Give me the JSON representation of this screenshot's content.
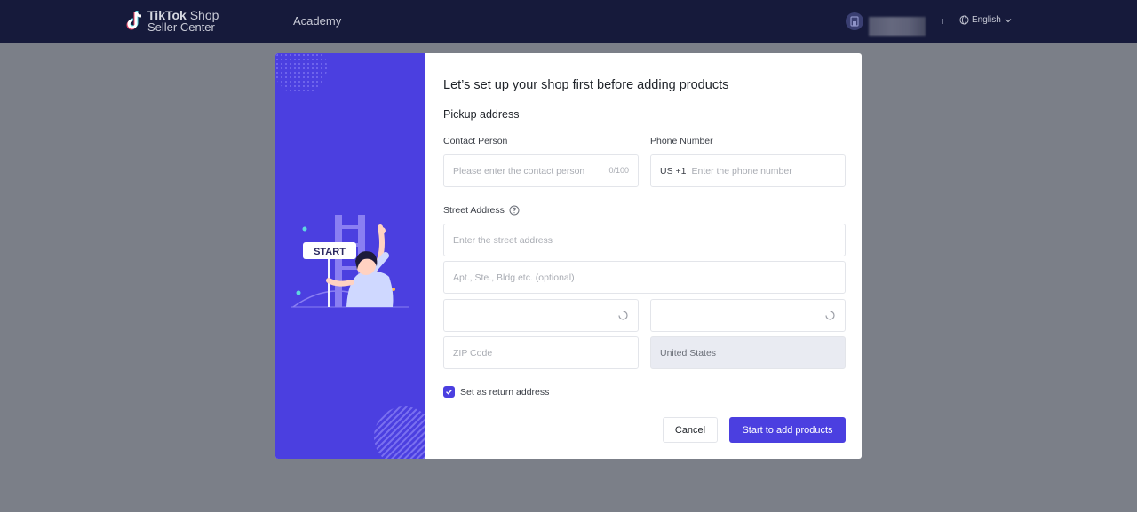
{
  "header": {
    "logo_brand": "TikTok",
    "logo_suffix": "Shop",
    "logo_line2": "Seller Center",
    "nav_academy": "Academy",
    "language": "English"
  },
  "modal": {
    "title": "Let’s set up your shop first before adding products",
    "section": "Pickup address",
    "contact_person": {
      "label": "Contact Person",
      "placeholder": "Please enter the contact person",
      "counter": "0/100"
    },
    "phone": {
      "label": "Phone Number",
      "prefix": "US +1",
      "placeholder": "Enter the phone number"
    },
    "street": {
      "label": "Street Address",
      "placeholder": "Enter the street address",
      "apt_placeholder": "Apt., Ste., Bldg.etc. (optional)"
    },
    "zip_placeholder": "ZIP Code",
    "country": "United States",
    "return_checkbox": {
      "label": "Set as return address",
      "checked": true
    },
    "cancel_label": "Cancel",
    "submit_label": "Start to add products",
    "illustration_sign": "START"
  },
  "colors": {
    "topbar": "#161a3b",
    "accent": "#4b3fe0",
    "overlay": "#7b7f88"
  }
}
